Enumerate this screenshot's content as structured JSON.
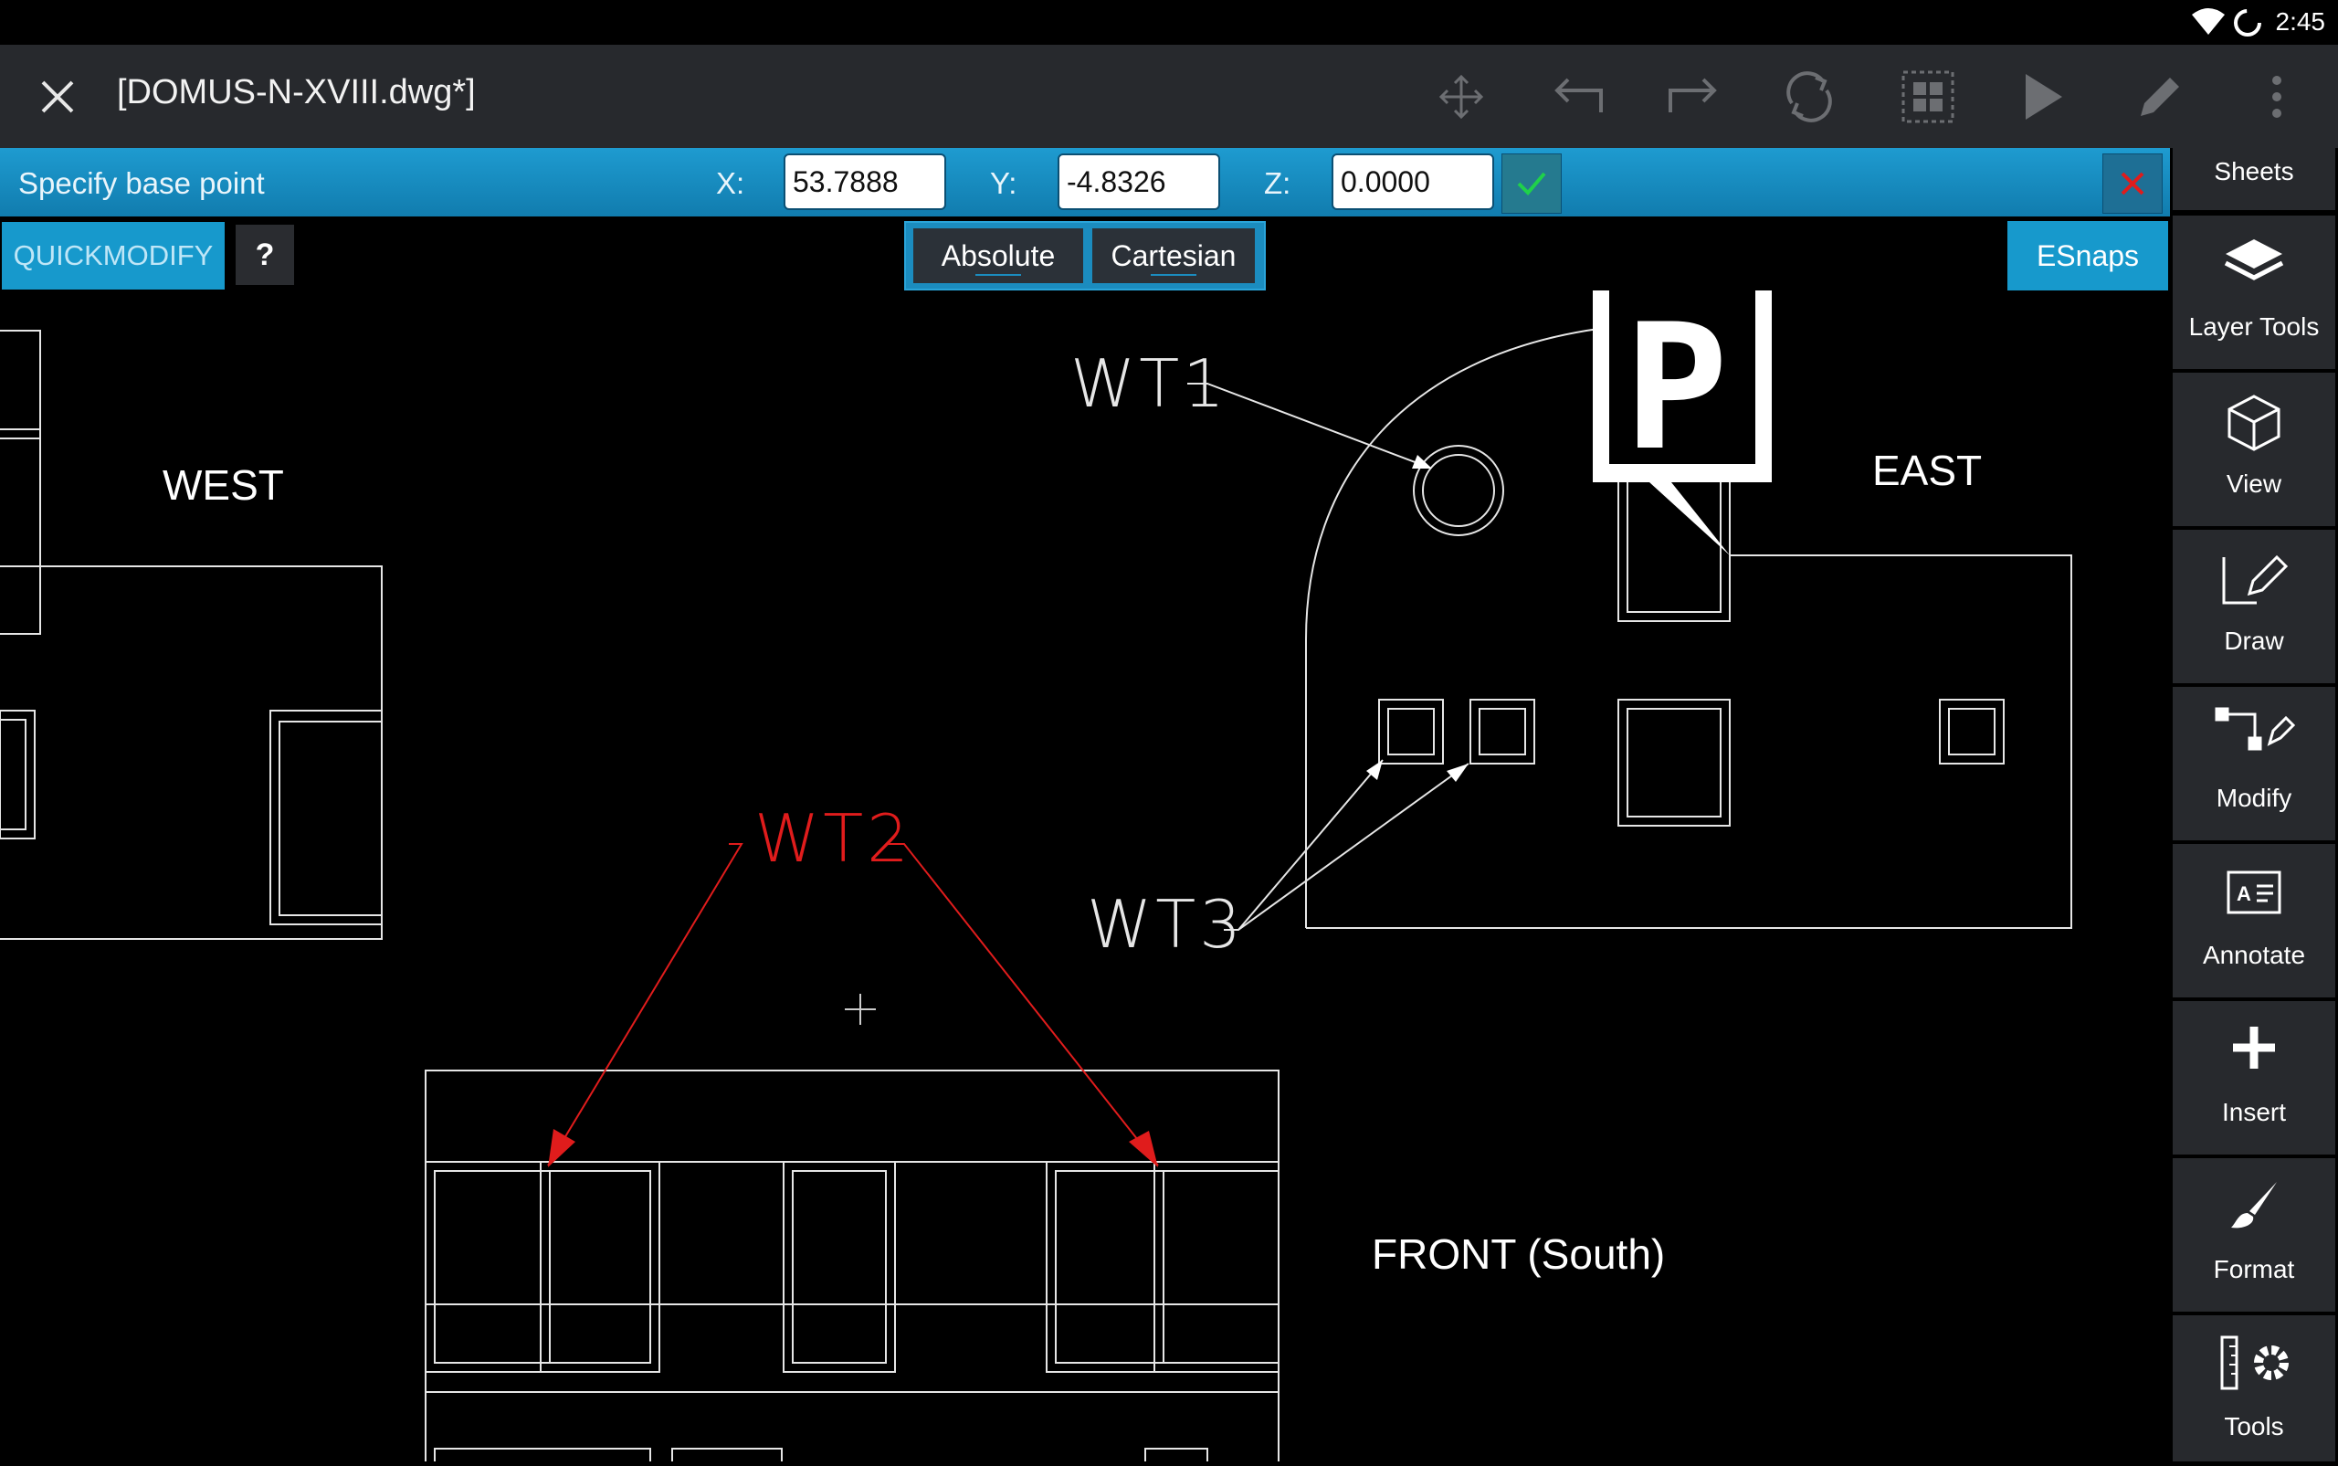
{
  "status": {
    "time": "2:45"
  },
  "toolbar": {
    "title": "[DOMUS-N-XVIII.dwg*]"
  },
  "command": {
    "prompt": "Specify base point",
    "x_label": "X:",
    "x_value": "53.7888",
    "y_label": "Y:",
    "y_value": "-4.8326",
    "z_label": "Z:",
    "z_value": "0.0000"
  },
  "secondary": {
    "quickmodify": "QUICKMODIFY",
    "help": "?",
    "absolute": "Absolute",
    "cartesian": "Cartesian",
    "esnaps": "ESnaps"
  },
  "sidebar": {
    "items": [
      {
        "label": "Sheets",
        "icon": "sheets-icon"
      },
      {
        "label": "Layer Tools",
        "icon": "layers-icon"
      },
      {
        "label": "View",
        "icon": "cube-icon"
      },
      {
        "label": "Draw",
        "icon": "pencil-line-icon"
      },
      {
        "label": "Modify",
        "icon": "modify-icon"
      },
      {
        "label": "Annotate",
        "icon": "annotate-icon"
      },
      {
        "label": "Insert",
        "icon": "plus-icon"
      },
      {
        "label": "Format",
        "icon": "brush-icon"
      },
      {
        "label": "Tools",
        "icon": "ruler-gear-icon"
      }
    ]
  },
  "drawing": {
    "west": "WEST",
    "east": "EAST",
    "front": "FRONT (South)",
    "wt1": "WT1",
    "wt2": "WT2",
    "wt3": "WT3",
    "parking_letter": "P"
  },
  "colors": {
    "accent": "#1799cc",
    "toolbar": "#27292d",
    "red": "#e01c1c"
  }
}
